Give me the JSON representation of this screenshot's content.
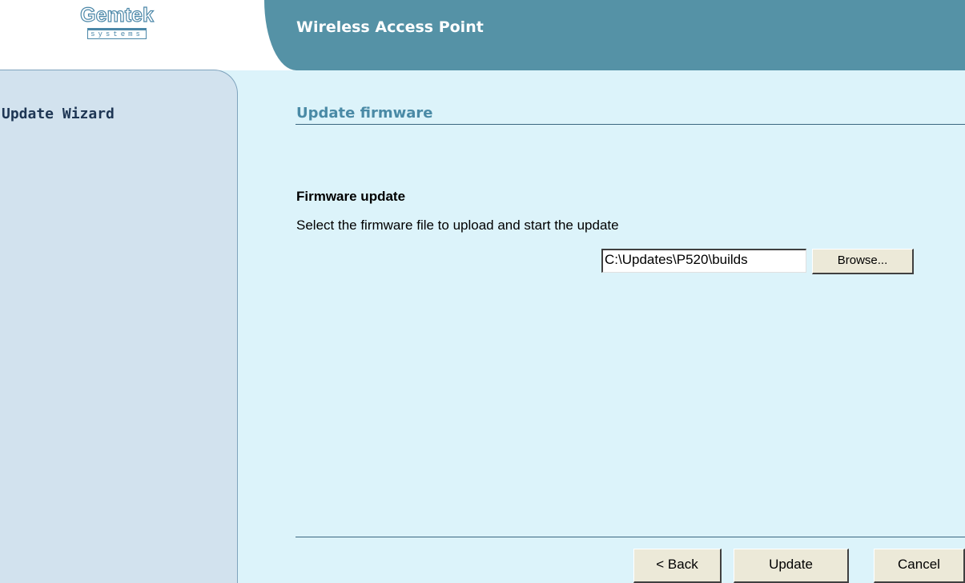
{
  "logo": {
    "brand": "Gemtek",
    "sub": "systems"
  },
  "header": {
    "title": "Wireless Access Point"
  },
  "sidebar": {
    "title": "Update Wizard"
  },
  "main": {
    "section_title": "Update firmware",
    "subsection_title": "Firmware update",
    "description": "Select the firmware file to upload and start the update",
    "file_input_value": "C:\\Updates\\P520\\builds",
    "browse_label": "Browse..."
  },
  "footer": {
    "back_label": "< Back",
    "update_label": "Update",
    "cancel_label": "Cancel"
  },
  "colors": {
    "background": "#dcf3fa",
    "header": "#5592a6",
    "sidebar": "#d2e2ee",
    "section_title": "#4a8aa6",
    "sidebar_title": "#1e3654"
  }
}
